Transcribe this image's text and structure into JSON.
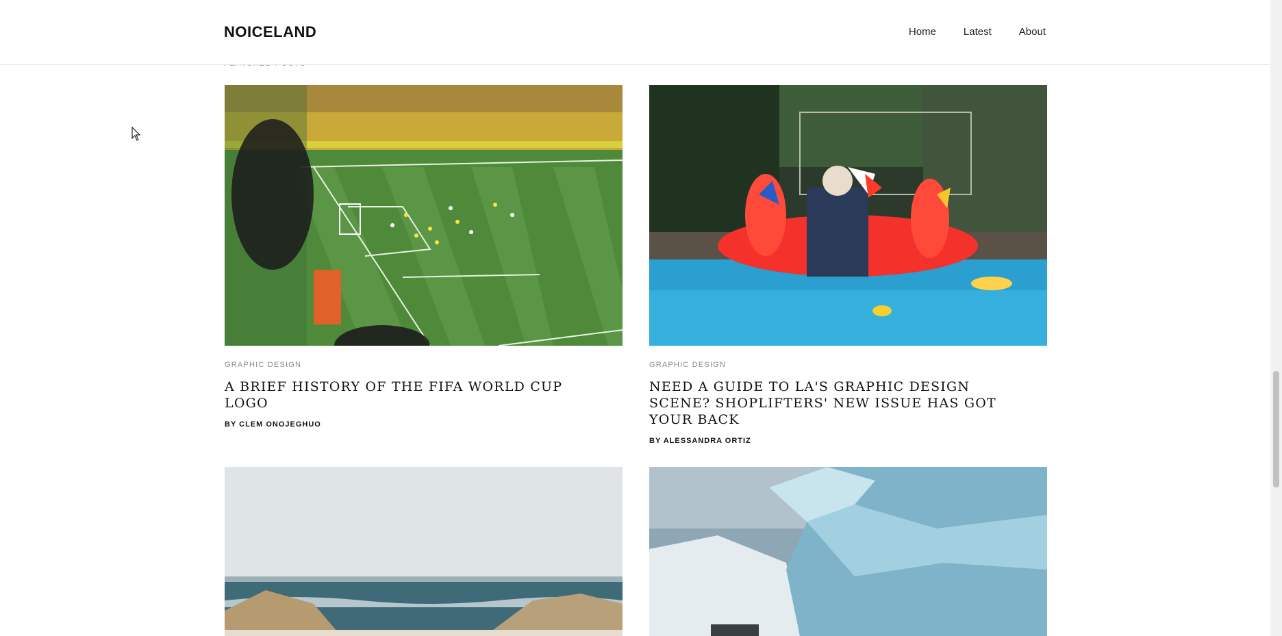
{
  "header": {
    "logo": "NOICELAND",
    "nav": [
      {
        "label": "Home"
      },
      {
        "label": "Latest"
      },
      {
        "label": "About"
      }
    ]
  },
  "section_label": "FEATURED POSTS",
  "posts": [
    {
      "category": "GRAPHIC DESIGN",
      "title": "A BRIEF HISTORY OF THE FIFA WORLD CUP LOGO",
      "author": "BY CLEM ONOJEGHUO",
      "image": "soccer-stadium"
    },
    {
      "category": "GRAPHIC DESIGN",
      "title": "NEED A GUIDE TO LA'S GRAPHIC DESIGN SCENE? SHOPLIFTERS' NEW ISSUE HAS GOT YOUR BACK",
      "author": "BY ALESSANDRA ORTIZ",
      "image": "pool-float"
    },
    {
      "image": "beach-dunes"
    },
    {
      "image": "glacier-ice"
    }
  ]
}
